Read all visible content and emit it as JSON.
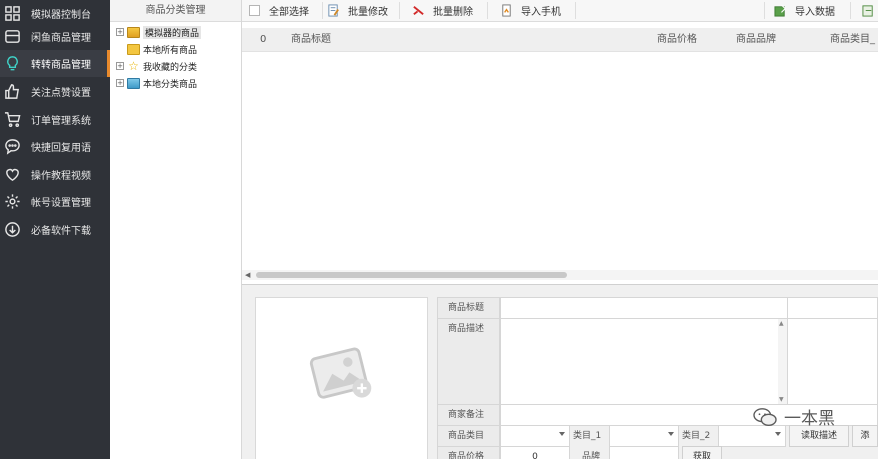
{
  "sidebar": {
    "items": [
      {
        "label": "模拟器控制台",
        "icon": "grid-icon",
        "active": false
      },
      {
        "label": "闲鱼商品管理",
        "icon": "store-icon",
        "active": false
      },
      {
        "label": "转转商品管理",
        "icon": "lightbulb-icon",
        "active": true
      },
      {
        "label": "关注点赞设置",
        "icon": "thumbs-up-icon",
        "active": false
      },
      {
        "label": "订单管理系统",
        "icon": "cart-icon",
        "active": false
      },
      {
        "label": "快捷回复用语",
        "icon": "chat-icon",
        "active": false
      },
      {
        "label": "操作教程视频",
        "icon": "heart-icon",
        "active": false
      },
      {
        "label": "帐号设置管理",
        "icon": "gear-icon",
        "active": false
      },
      {
        "label": "必备软件下载",
        "icon": "download-icon",
        "active": false
      }
    ],
    "accent": "#e88a2c",
    "active_icon_color": "#3fd3c8"
  },
  "tree": {
    "header": "商品分类管理",
    "nodes": [
      {
        "label": "模拟器的商品",
        "expand": "+",
        "icon": "store-folder-icon",
        "selected": true
      },
      {
        "label": "本地所有商品",
        "expand": "",
        "icon": "folder-icon",
        "selected": false
      },
      {
        "label": "我收藏的分类",
        "expand": "+",
        "icon": "star-icon",
        "selected": false
      },
      {
        "label": "本地分类商品",
        "expand": "+",
        "icon": "category-folder-icon",
        "selected": false
      }
    ]
  },
  "toolbar": {
    "select_all": "全部选择",
    "batch_edit": "批量修改",
    "batch_delete": "批量删除",
    "import_phone": "导入手机",
    "import_data": "导入数据"
  },
  "grid": {
    "columns": [
      "0",
      "商品标题",
      "商品价格",
      "商品品牌",
      "商品类目_"
    ]
  },
  "form": {
    "title_label": "商品标题",
    "desc_label": "商品描述",
    "note_label": "商家备注",
    "category_label": "商品类目",
    "cat1_label": "类目_1",
    "cat2_label": "类目_2",
    "read_desc_button": "读取描述",
    "add_button": "添",
    "price_label": "商品价格",
    "price_value": "0",
    "brand_label": "品牌",
    "fetch_button": "获取"
  },
  "watermark": "一本黑"
}
